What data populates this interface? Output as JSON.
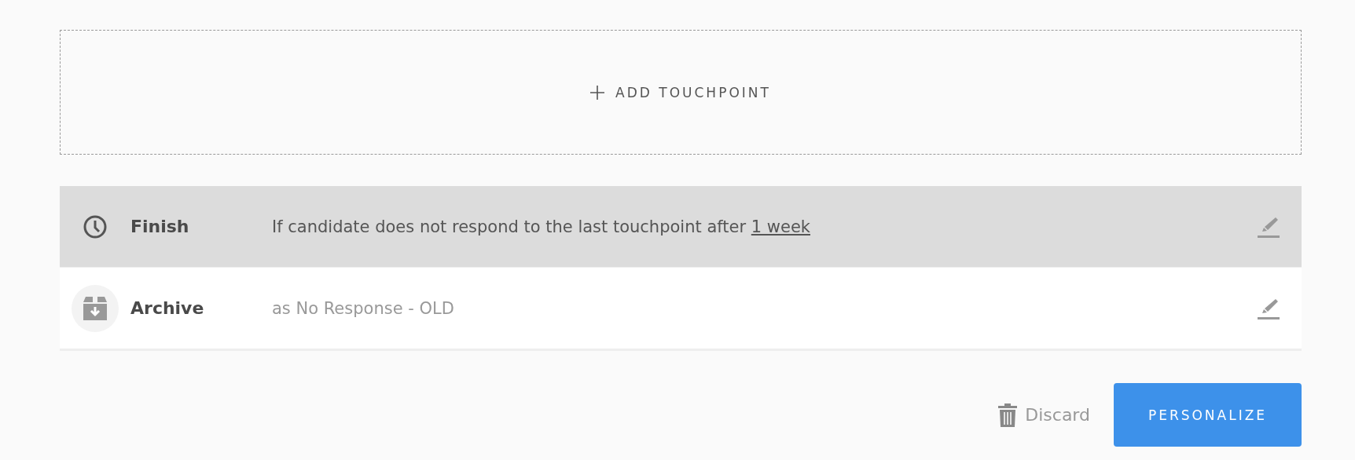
{
  "add_touchpoint": {
    "label": "ADD TOUCHPOINT"
  },
  "rows": [
    {
      "kind": "finish",
      "highlighted": true,
      "label": "Finish",
      "description": "If candidate does not respond to the last touchpoint after",
      "link": "1 week"
    },
    {
      "kind": "archive",
      "highlighted": false,
      "label": "Archive",
      "description": "as No Response - OLD"
    }
  ],
  "actions": [
    {
      "kind": "discard",
      "label": "Discard"
    },
    {
      "kind": "primary",
      "label": "PERSONALIZE"
    }
  ]
}
